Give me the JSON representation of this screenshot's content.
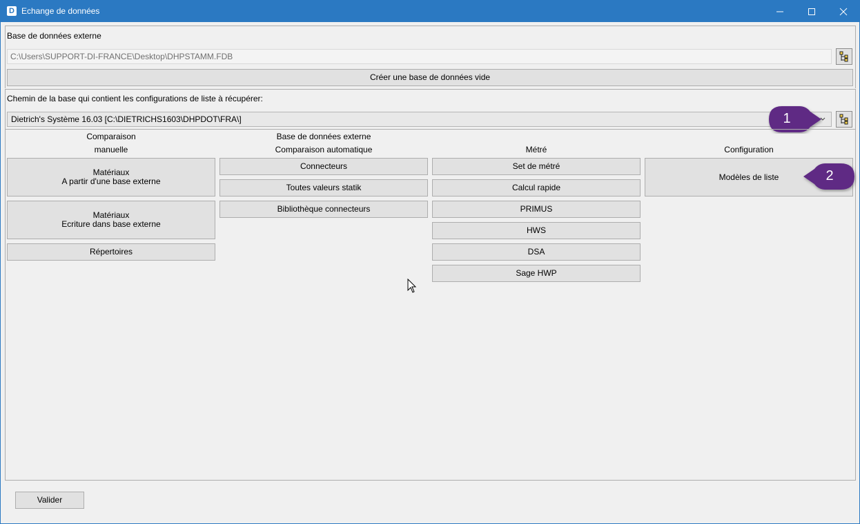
{
  "window": {
    "title": "Echange de données",
    "icon_letter": "D"
  },
  "external_db": {
    "label": "Base de données externe",
    "path": "C:\\Users\\SUPPORT-DI-FRANCE\\Desktop\\DHPSTAMM.FDB",
    "create_button": "Créer une base de données vide"
  },
  "config_db": {
    "label": "Chemin de la base qui contient les configurations de liste à récupérer:",
    "selected": "Dietrich's Système 16.03 [C:\\DIETRICHS1603\\DHPDOT\\FRA\\]"
  },
  "columns": {
    "manual": {
      "header_line1": "Comparaison",
      "header_line2": "manuelle",
      "buttons": [
        {
          "line1": "Matériaux",
          "line2": "A partir d'une base externe"
        },
        {
          "line1": "Matériaux",
          "line2": "Ecriture dans base externe"
        },
        {
          "line1": "Répertoires",
          "line2": ""
        }
      ]
    },
    "auto": {
      "header_line1": "Base de données externe",
      "header_line2": "Comparaison automatique",
      "buttons": [
        "Connecteurs",
        "Toutes valeurs statik",
        "Bibliothèque connecteurs"
      ]
    },
    "metre": {
      "header": "Métré",
      "buttons": [
        "Set de métré",
        "Calcul rapide",
        "PRIMUS",
        "HWS",
        "DSA",
        "Sage HWP"
      ]
    },
    "config": {
      "header": "Configuration",
      "buttons": [
        "Modèles de liste"
      ]
    }
  },
  "callouts": [
    "1",
    "2"
  ],
  "footer": {
    "ok_button": "Valider"
  },
  "colors": {
    "titlebar": "#2b79c2",
    "callout": "#5e2a84",
    "button": "#e1e1e1",
    "border": "#adadad"
  },
  "icons": [
    "app-icon",
    "minimize-icon",
    "maximize-icon",
    "close-icon",
    "tree-browse-icon",
    "chevron-down-icon",
    "mouse-cursor-icon"
  ]
}
